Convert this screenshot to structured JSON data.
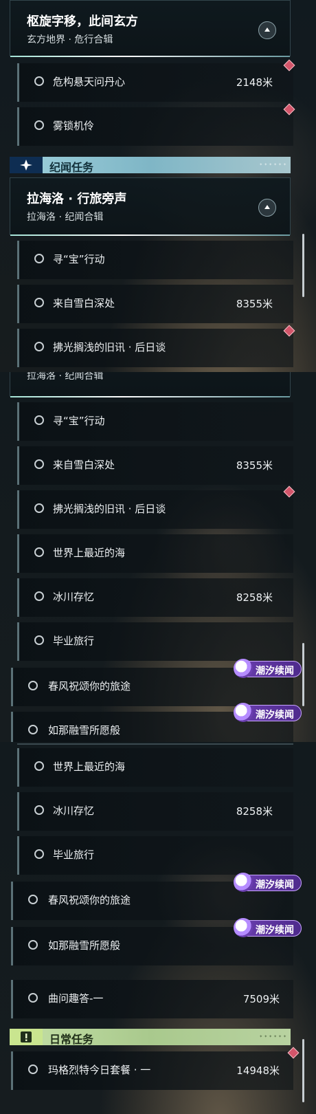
{
  "panel1": {
    "header": {
      "title": "枢旋字移，此间玄方",
      "subtitle": "玄方地界 · 危行合辑"
    },
    "rows": [
      {
        "label": "危构悬天问丹心",
        "dist": "2148米"
      },
      {
        "label": "雾锁机伶",
        "dist": ""
      }
    ],
    "section": {
      "title": "纪闻任务"
    },
    "header2": {
      "title": "拉海洛 · 行旅旁声",
      "subtitle": "拉海洛 · 纪闻合辑"
    },
    "rows2": [
      {
        "label": "寻“宝”行动",
        "dist": ""
      },
      {
        "label": "来自雪白深处",
        "dist": "8355米"
      },
      {
        "label": "拂光搁浅的旧讯 · 后日谈",
        "dist": ""
      }
    ]
  },
  "panel2": {
    "header_subtitle": "拉海洛 · 纪闻合辑",
    "rows": [
      {
        "label": "寻“宝”行动",
        "dist": ""
      },
      {
        "label": "来自雪白深处",
        "dist": "8355米"
      },
      {
        "label": "拂光搁浅的旧讯 · 后日谈",
        "dist": ""
      },
      {
        "label": "世界上最近的海",
        "dist": ""
      },
      {
        "label": "冰川存忆",
        "dist": "8258米"
      },
      {
        "label": "毕业旅行",
        "dist": ""
      },
      {
        "label": "春风祝颂你的旅途",
        "dist": ""
      },
      {
        "label": "如那融雪所愿般",
        "dist": ""
      }
    ],
    "badge": "潮汐续闻"
  },
  "panel3": {
    "rows": [
      {
        "label": "世界上最近的海",
        "dist": ""
      },
      {
        "label": "冰川存忆",
        "dist": "8258米"
      },
      {
        "label": "毕业旅行",
        "dist": ""
      },
      {
        "label": "春风祝颂你的旅途",
        "dist": ""
      },
      {
        "label": "如那融雪所愿般",
        "dist": ""
      },
      {
        "label": "曲问趣答-一",
        "dist": "7509米"
      }
    ],
    "badge": "潮汐续闻",
    "section": {
      "title": "日常任务"
    },
    "daily_rows": [
      {
        "label": "玛格烈特今日套餐 · 一",
        "dist": "14948米"
      }
    ]
  },
  "colors": {
    "section_blue": "#7fb6c6",
    "section_green": "#a9c98d",
    "badge_purple": "#6b3fb0",
    "track_diamond": "#d3556a"
  },
  "icons": {
    "quest_circle": "circle-outline-icon",
    "tracked": "red-diamond-icon",
    "collapse": "chevron-up-icon",
    "section_star": "sparkle-icon",
    "section_daily": "exclamation-icon",
    "badge": "tide-swirl-icon"
  }
}
